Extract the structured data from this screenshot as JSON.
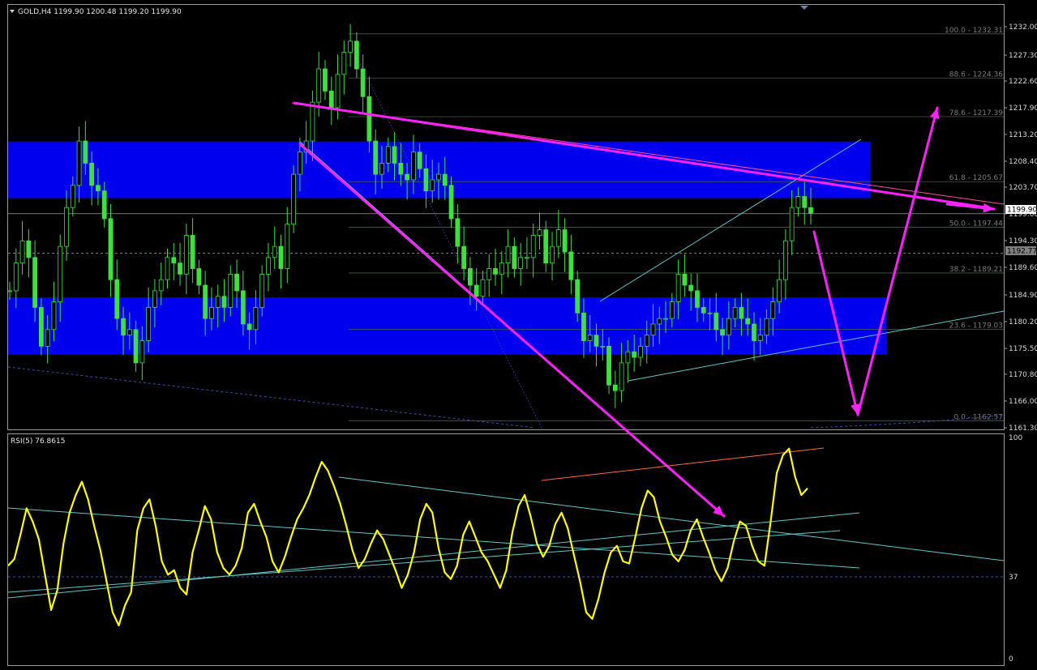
{
  "symbol_header": {
    "text": "GOLD,H4  1199.90 1200.48 1199.20 1199.90"
  },
  "chart_data": {
    "type": "candlestick",
    "price_panel": {
      "ylim": [
        1161.3,
        1233.6
      ],
      "yticks": [
        "1232.00",
        "1227.30",
        "1222.60",
        "1217.90",
        "1213.20",
        "1208.40",
        "1203.70",
        "1199.00",
        "1194.30",
        "1189.60",
        "1184.90",
        "1180.20",
        "1175.50",
        "1170.80",
        "1166.00",
        "1161.30"
      ],
      "current_price": {
        "value": 1199.9,
        "label": "1199.90"
      },
      "dashed_level": {
        "value": 1192.77,
        "label": "1192.77"
      },
      "close_series": [
        1186,
        1191,
        1195,
        1192,
        1183,
        1176,
        1179,
        1184,
        1194,
        1201,
        1205,
        1213,
        1209,
        1205,
        1204,
        1199,
        1188,
        1181,
        1178,
        1179,
        1173,
        1177,
        1183,
        1186,
        1188,
        1192,
        1191,
        1189,
        1196,
        1190,
        1187,
        1181,
        1183,
        1185,
        1183,
        1189,
        1186,
        1180,
        1179,
        1183,
        1189,
        1192,
        1194,
        1190,
        1198,
        1207,
        1211,
        1213,
        1220,
        1226,
        1222,
        1219,
        1225,
        1229,
        1231,
        1226,
        1221,
        1213,
        1207,
        1209,
        1212,
        1209,
        1207,
        1206,
        1211,
        1208,
        1204,
        1206,
        1207,
        1205,
        1199,
        1194,
        1190,
        1187,
        1185,
        1188,
        1190,
        1189,
        1191,
        1194,
        1190,
        1192,
        1192,
        1196,
        1197,
        1191,
        1194,
        1197,
        1193,
        1188,
        1182,
        1177,
        1178,
        1176,
        1176,
        1169,
        1168,
        1173,
        1175,
        1174,
        1176,
        1178,
        1180,
        1181,
        1181,
        1184,
        1189,
        1187,
        1186,
        1183,
        1182,
        1182,
        1179,
        1178,
        1181,
        1183,
        1181,
        1180,
        1177,
        1178,
        1181,
        1184,
        1188,
        1195,
        1201,
        1203,
        1201,
        1200
      ],
      "annotations": [
        "100.0 - 1232.31",
        "88.6 - 1224.36",
        "78.6 - 1217.39",
        "61.8 - 1205.67",
        "50.0 - 1197.44",
        "38.2 - 1189.21",
        "23.6 - 1179.03",
        "0.0 - 1162.57"
      ],
      "fibonacci": [
        {
          "label": "100.0 - 1232.31",
          "value": 1232.31
        },
        {
          "label": "88.6 - 1224.36",
          "value": 1224.36
        },
        {
          "label": "78.6 - 1217.39",
          "value": 1217.39
        },
        {
          "label": "61.8 - 1205.67",
          "value": 1205.67
        },
        {
          "label": "50.0 - 1197.44",
          "value": 1197.44
        },
        {
          "label": "38.2 - 1189.21",
          "value": 1189.21
        },
        {
          "label": "23.6 - 1179.03",
          "value": 1179.03
        },
        {
          "label": "0.0 - 1162.57",
          "value": 1162.57
        }
      ],
      "zones": [
        {
          "low": 1202.7,
          "high": 1212.9
        },
        {
          "low": 1174.5,
          "high": 1184.8
        }
      ]
    },
    "rsi_panel": {
      "title": "RSI(5) 76.8615",
      "ylim": [
        0,
        100
      ],
      "yticks": [
        "100",
        "37",
        "0"
      ],
      "level": 37,
      "values": [
        42,
        45,
        56,
        68,
        62,
        54,
        38,
        22,
        31,
        52,
        66,
        74,
        80,
        72,
        60,
        49,
        35,
        21,
        15,
        24,
        30,
        58,
        68,
        72,
        60,
        44,
        38,
        40,
        32,
        29,
        48,
        58,
        69,
        63,
        48,
        41,
        38,
        42,
        50,
        66,
        70,
        62,
        55,
        44,
        39,
        46,
        55,
        63,
        68,
        74,
        82,
        89,
        85,
        78,
        70,
        60,
        49,
        41,
        45,
        52,
        58,
        54,
        47,
        40,
        32,
        38,
        48,
        63,
        70,
        66,
        50,
        39,
        36,
        42,
        56,
        62,
        55,
        48,
        44,
        38,
        32,
        40,
        57,
        69,
        74,
        64,
        52,
        46,
        51,
        61,
        66,
        59,
        47,
        35,
        21,
        18,
        27,
        39,
        48,
        51,
        44,
        43,
        55,
        68,
        76,
        73,
        62,
        55,
        47,
        44,
        49,
        58,
        63,
        55,
        48,
        40,
        35,
        41,
        53,
        62,
        60,
        51,
        44,
        42,
        62,
        84,
        92,
        95,
        82,
        74,
        77
      ]
    }
  }
}
